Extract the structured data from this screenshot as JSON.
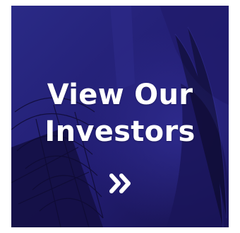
{
  "card": {
    "title_line1": "View Our",
    "title_line2": "Investors",
    "arrow_icon": "double-chevron-right-icon"
  },
  "colors": {
    "overlay": "#1f1a66",
    "overlay_light": "#2b2a8a",
    "text": "#ffffff"
  }
}
